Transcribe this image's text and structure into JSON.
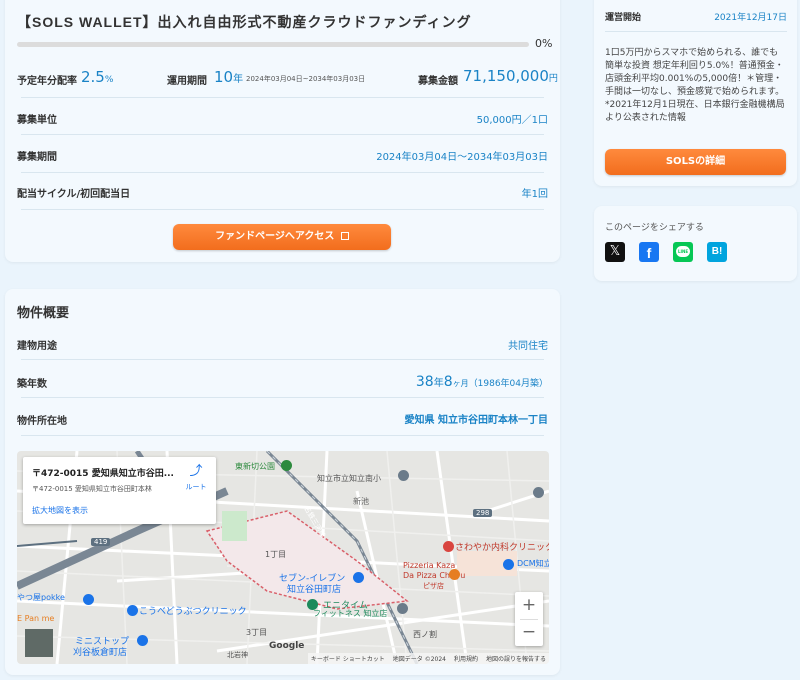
{
  "fund": {
    "title": "【SOLS WALLET】出入れ自由形式不動産クラウドファンディング",
    "progress_text": "0%",
    "progress_value": 0,
    "yield_label": "予定年分配率",
    "yield_value": "2.5",
    "yield_unit": "%",
    "period_label": "運用期間",
    "period_value": "10",
    "period_unit": "年",
    "period_range": "2024年03月04日~2034年03月03日",
    "amount_label": "募集金額",
    "amount_value": "71,150,000",
    "amount_unit": "円",
    "rows": [
      {
        "label": "募集単位",
        "value": "50,000円／1口"
      },
      {
        "label": "募集期間",
        "value": "2024年03月04日〜2034年03月03日"
      },
      {
        "label": "配当サイクル/初回配当日",
        "value": "年1回"
      }
    ],
    "fund_button": "ファンドページへアクセス",
    "external_icon": "external-link-icon"
  },
  "property": {
    "heading": "物件概要",
    "use_label": "建物用途",
    "use_value": "共同住宅",
    "age_label": "築年数",
    "age_years": "38",
    "age_year_unit": "年",
    "age_months": "8",
    "age_month_unit": "ヶ月",
    "age_built": "（1986年04月築）",
    "location_label": "物件所在地",
    "location_pref": "愛知県",
    "location_addr": "知立市谷田町本林一丁目"
  },
  "map": {
    "card_title": "〒472-0015 愛知県知立市谷田...",
    "card_address": "〒472-0015 愛知県知立市谷田町本林",
    "route_label": "ルート",
    "enlarge_link": "拡大地図を表示",
    "zoom_in": "+",
    "zoom_out": "−",
    "google": "Google",
    "footer_shortcuts": "キーボード ショートカット",
    "footer_data": "地図データ ©2024",
    "footer_terms": "利用規約",
    "footer_report": "地図の誤りを報告する",
    "labels": {
      "east_shinchi": "東新切公園",
      "chiryu_south": "知立市立知立南小",
      "shinchi": "新池",
      "meitetsu": "名鉄三河線",
      "chome1": "1丁目",
      "sawayaka": "さわやか内科クリニック",
      "pizzeria1": "Pizzeria Kaza",
      "pizzeria2": "Da Pizza Chiryu",
      "pizza_jp": "ピザ店",
      "dcm": "DCM知立",
      "seven1": "セブン-イレブン",
      "seven2": "知立谷田町店",
      "anytime1": "エニタイム",
      "anytime2": "フィットネス 知立店",
      "kohodo": "こうべどうぶつクリニック",
      "ministop1": "ミニストップ",
      "ministop2": "刈谷板倉町店",
      "yatsu": "やつ屋pokke",
      "panme": "E Pan me",
      "chome3": "3丁目",
      "nishino": "西ノ割",
      "shimogo": "北岩神",
      "r419": "419",
      "r298": "298",
      "r15": "15"
    }
  },
  "sidebar": {
    "start_label": "運営開始",
    "start_value": "2021年12月17日",
    "description": "1口5万円からスマホで始められる、誰でも簡単な投資 想定年利回り5.0%！普通預金・店頭金利平均0.001%の5,000倍！＊管理・手間は一切なし、預金感覚で始められます。 *2021年12月1日現在、日本銀行金融機構局より公表された情報",
    "details_button": "SOLSの詳細",
    "share_label": "このページをシェアする",
    "share_icons": [
      "x-icon",
      "facebook-icon",
      "line-icon",
      "hatena-icon"
    ],
    "line_text": "LINE",
    "hatena_text": "B!"
  },
  "colors": {
    "accent_blue": "#1a83c6",
    "orange": "#f26d1d",
    "background": "#eaf4fc",
    "card": "#f3f9fe"
  }
}
